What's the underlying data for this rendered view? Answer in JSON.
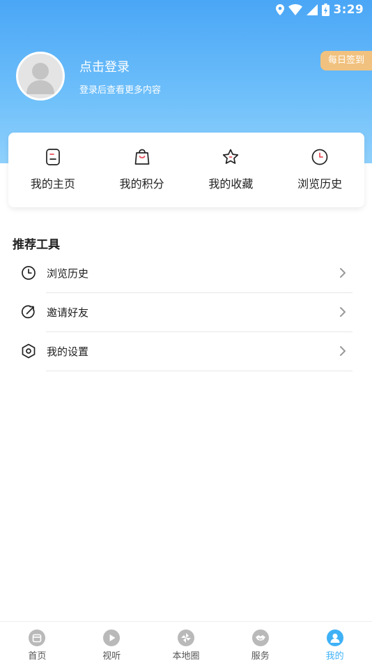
{
  "status_bar": {
    "time": "3:29"
  },
  "profile": {
    "login_title": "点击登录",
    "login_subtitle": "登录后查看更多内容",
    "daily_signin": "每日签到"
  },
  "quick_actions": [
    {
      "label": "我的主页",
      "icon": "homepage-icon"
    },
    {
      "label": "我的积分",
      "icon": "shopping-bag-icon"
    },
    {
      "label": "我的收藏",
      "icon": "star-icon"
    },
    {
      "label": "浏览历史",
      "icon": "clock-icon"
    }
  ],
  "tools": {
    "title": "推荐工具",
    "items": [
      {
        "label": "浏览历史",
        "icon": "clock-icon"
      },
      {
        "label": "邀请好友",
        "icon": "share-icon"
      },
      {
        "label": "我的设置",
        "icon": "settings-icon"
      }
    ]
  },
  "tabbar": {
    "items": [
      {
        "label": "首页",
        "icon": "home-icon"
      },
      {
        "label": "视听",
        "icon": "play-icon"
      },
      {
        "label": "本地圈",
        "icon": "pinwheel-icon"
      },
      {
        "label": "服务",
        "icon": "handshake-icon"
      },
      {
        "label": "我的",
        "icon": "profile-icon"
      }
    ],
    "active_index": 4
  },
  "colors": {
    "hero_top": "#4aa6f6",
    "hero_bottom": "#8fd0fc",
    "signin_bg": "#f1c27f",
    "accent_red": "#e8505b",
    "tab_active": "#3fb1f6",
    "tab_inactive": "#b9b9b9"
  }
}
